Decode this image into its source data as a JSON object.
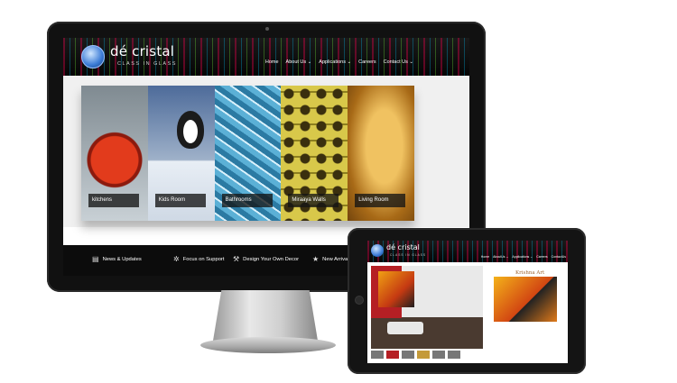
{
  "site": {
    "brand": "dé cristal",
    "tagline": "CLASS IN GLASS",
    "nav": [
      "Home",
      "About Us ⌄",
      "Applications ⌄",
      "Careers",
      "Contact Us ⌄"
    ]
  },
  "slider": {
    "slides": [
      {
        "label": "kitchens"
      },
      {
        "label": "Kids Room"
      },
      {
        "label": "Bathrooms"
      },
      {
        "label": "Miraaya Walls"
      },
      {
        "label": "Living Room"
      }
    ]
  },
  "features": [
    {
      "icon": "news-icon",
      "label": "News & Updates"
    },
    {
      "icon": "gear-icon",
      "label": "Focus on Support"
    },
    {
      "icon": "hammer-icon",
      "label": "Design Your Own Decor"
    },
    {
      "icon": "star-icon",
      "label": "New Arrivals"
    }
  ],
  "tablet": {
    "brand": "dé cristal",
    "tagline": "CLASS IN GLASS",
    "nav": [
      "Home",
      "AboutUs ⌄",
      "Applications ⌄",
      "Careers",
      "ContactUs"
    ],
    "art_title": "Krishna Art"
  }
}
